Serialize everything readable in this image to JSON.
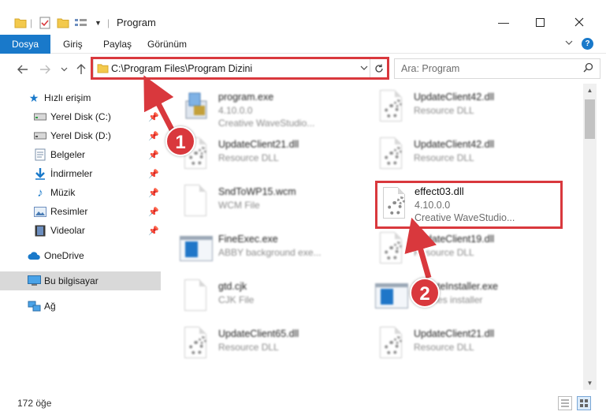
{
  "window": {
    "title": "Program"
  },
  "ribbon": {
    "tabs": [
      {
        "label": "Dosya"
      },
      {
        "label": "Giriş"
      },
      {
        "label": "Paylaş"
      },
      {
        "label": "Görünüm"
      }
    ]
  },
  "toolbar": {
    "address_path": "C:\\Program Files\\Program Dizini",
    "search_placeholder": "Ara: Program"
  },
  "nav": {
    "quick_access": "Hızlı erişim",
    "items": [
      {
        "label": "Yerel Disk (C:)",
        "icon": "drive-icon",
        "pinned": true
      },
      {
        "label": "Yerel Disk (D:)",
        "icon": "drive-icon",
        "pinned": true
      },
      {
        "label": "Belgeler",
        "icon": "documents-icon",
        "pinned": true
      },
      {
        "label": "İndirmeler",
        "icon": "download-icon",
        "pinned": true
      },
      {
        "label": "Müzik",
        "icon": "music-icon",
        "pinned": true
      },
      {
        "label": "Resimler",
        "icon": "pictures-icon",
        "pinned": true
      },
      {
        "label": "Videolar",
        "icon": "videos-icon",
        "pinned": true
      }
    ],
    "onedrive": "OneDrive",
    "this_pc": "Bu bilgisayar",
    "network": "Ağ"
  },
  "files": [
    {
      "name": "program.exe",
      "line2": "4.10.0.0",
      "line3": "Creative WaveStudio...",
      "kind": "exe"
    },
    {
      "name": "UpdateClient42.dll",
      "line2": "Resource DLL",
      "line3": "",
      "kind": "dll"
    },
    {
      "name": "UpdateClient21.dll",
      "line2": "Resource DLL",
      "line3": "",
      "kind": "dll"
    },
    {
      "name": "UpdateClient42.dll",
      "line2": "Resource DLL",
      "line3": "",
      "kind": "dll"
    },
    {
      "name": "SndToWP15.wcm",
      "line2": "WCM File",
      "line3": "",
      "kind": "doc"
    },
    {
      "name": "FineExec.exe",
      "line2": "ABBY background exe...",
      "line3": "",
      "kind": "exe"
    },
    {
      "name": "UpdateClient19.dll",
      "line2": "Resource DLL",
      "line3": "",
      "kind": "dll"
    },
    {
      "name": "gtd.cjk",
      "line2": "CJK File",
      "line3": "",
      "kind": "doc"
    },
    {
      "name": "UpdateInstaller.exe",
      "line2": "updates installer",
      "line3": "",
      "kind": "exe"
    },
    {
      "name": "UpdateClient65.dll",
      "line2": "Resource DLL",
      "line3": "",
      "kind": "dll"
    },
    {
      "name": "UpdateClient21.dll",
      "line2": "Resource DLL",
      "line3": "",
      "kind": "dll"
    }
  ],
  "highlighted_file": {
    "name": "effect03.dll",
    "version": "4.10.0.0",
    "description": "Creative WaveStudio..."
  },
  "status": {
    "count": "172 öğe"
  },
  "annotations": {
    "step1": "1",
    "step2": "2",
    "color": "#d9383d"
  },
  "colors": {
    "file_tab": "#1979ca",
    "selected_nav": "#d9d9d9"
  }
}
